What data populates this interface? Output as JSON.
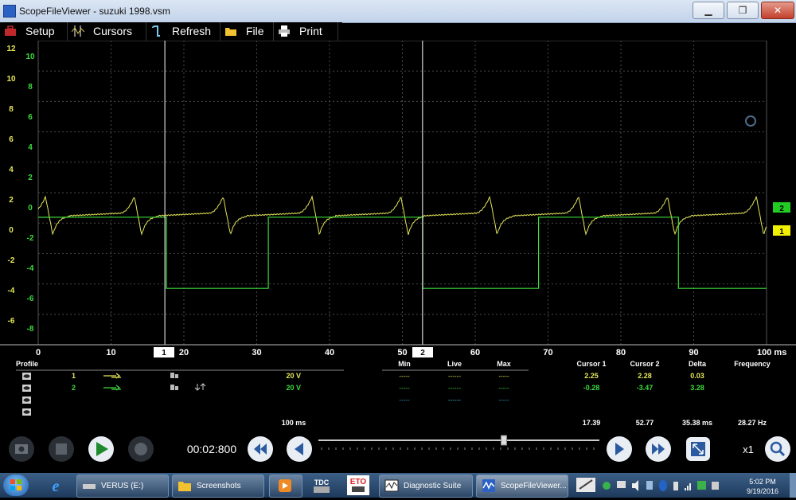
{
  "window": {
    "title": "ScopeFileViewer - suzuki 1998.vsm",
    "minimize_glyph": "▁",
    "restore_glyph": "❐",
    "close_glyph": "✕"
  },
  "toolbar": {
    "items": [
      {
        "label": "Setup",
        "icon": "toolbox-icon"
      },
      {
        "label": "Cursors",
        "icon": "cursors-icon"
      },
      {
        "label": "Refresh",
        "icon": "refresh-icon"
      },
      {
        "label": "File",
        "icon": "folder-icon"
      },
      {
        "label": "Print",
        "icon": "printer-icon"
      }
    ]
  },
  "scope": {
    "left_axis_outer": [
      "12",
      "10",
      "8",
      "6",
      "4",
      "2",
      "0",
      "-2",
      "-4",
      "-6"
    ],
    "left_axis_inner": [
      "10",
      "8",
      "6",
      "4",
      "2",
      "0",
      "-2",
      "-4",
      "-6",
      "-8"
    ],
    "x_ticks": [
      "0",
      "10",
      "20",
      "30",
      "40",
      "50",
      "60",
      "70",
      "80",
      "90",
      "100 ms"
    ],
    "cursor1_label": "1",
    "cursor2_label": "2",
    "cursor1_time_ms": 17.39,
    "cursor2_time_ms": 52.77,
    "channel2_badge": "2",
    "channel1_badge": "1",
    "colors": {
      "channel1": "#e6e65a",
      "channel2": "#3ddc3d",
      "grid": "#4a4a4a"
    }
  },
  "chart_data": {
    "type": "line",
    "xlabel": "",
    "ylabel": "",
    "xlim": [
      0,
      100
    ],
    "x_tick_labels": [
      "0",
      "10",
      "20",
      "30",
      "40",
      "50",
      "60",
      "70",
      "80",
      "90",
      "100 ms"
    ],
    "series": [
      {
        "name": "1",
        "color": "#e6e65a",
        "period_ms": 12.2,
        "first_peak_ms": 1.0,
        "peak_v": 2.5,
        "trough_v": -0.5,
        "plateau_v": 1.0
      },
      {
        "name": "2",
        "color": "#3ddc3d",
        "high_v": -0.28,
        "low_v": -3.47,
        "transitions_ms": [
          17.6,
          31.6,
          52.8,
          68.7,
          87.9
        ],
        "levels": [
          "high",
          "low",
          "high",
          "low",
          "high",
          "low"
        ]
      }
    ]
  },
  "measurements": {
    "profile_label": "Profile",
    "headers": {
      "min": "Min",
      "live": "Live",
      "max": "Max",
      "cursor1": "Cursor 1",
      "cursor2": "Cursor 2",
      "delta": "Delta",
      "frequency": "Frequency"
    },
    "channels": [
      {
        "num": "1",
        "scale": "20 V",
        "min": "-----",
        "live": "------",
        "max": "-----",
        "cursor1": "2.25",
        "cursor2": "2.28",
        "delta": "0.03",
        "color": "#e6e65a"
      },
      {
        "num": "2",
        "scale": "20 V",
        "min": "-----",
        "live": "------",
        "max": "-----",
        "cursor1": "-0.28",
        "cursor2": "-3.47",
        "delta": "3.28",
        "color": "#3ddc3d"
      }
    ],
    "extra_row": {
      "min": "-----",
      "live": "------",
      "max": "-----"
    },
    "timebase": "100 ms",
    "cursor1_time": "17.39",
    "cursor2_time": "52.77",
    "delta_time": "35.38 ms",
    "frequency": "28.27 Hz"
  },
  "playback": {
    "timecode": "00:02:800",
    "zoom": "x1",
    "slider_position_pct": 66
  },
  "taskbar": {
    "items": [
      {
        "label": "VERUS (E:)",
        "icon": "drive-icon"
      },
      {
        "label": "Screenshots",
        "icon": "folder-icon"
      },
      {
        "label": "",
        "icon": "media-player-icon"
      },
      {
        "label": "TDC",
        "icon": "tdc-icon"
      },
      {
        "label": "ETO",
        "icon": "eto-icon"
      },
      {
        "label": "Diagnostic Suite",
        "icon": "diagnostic-suite-icon"
      },
      {
        "label": "ScopeFileViewer...",
        "icon": "scope-viewer-icon"
      }
    ],
    "clock_time": "5:02 PM",
    "clock_date": "9/19/2016"
  }
}
